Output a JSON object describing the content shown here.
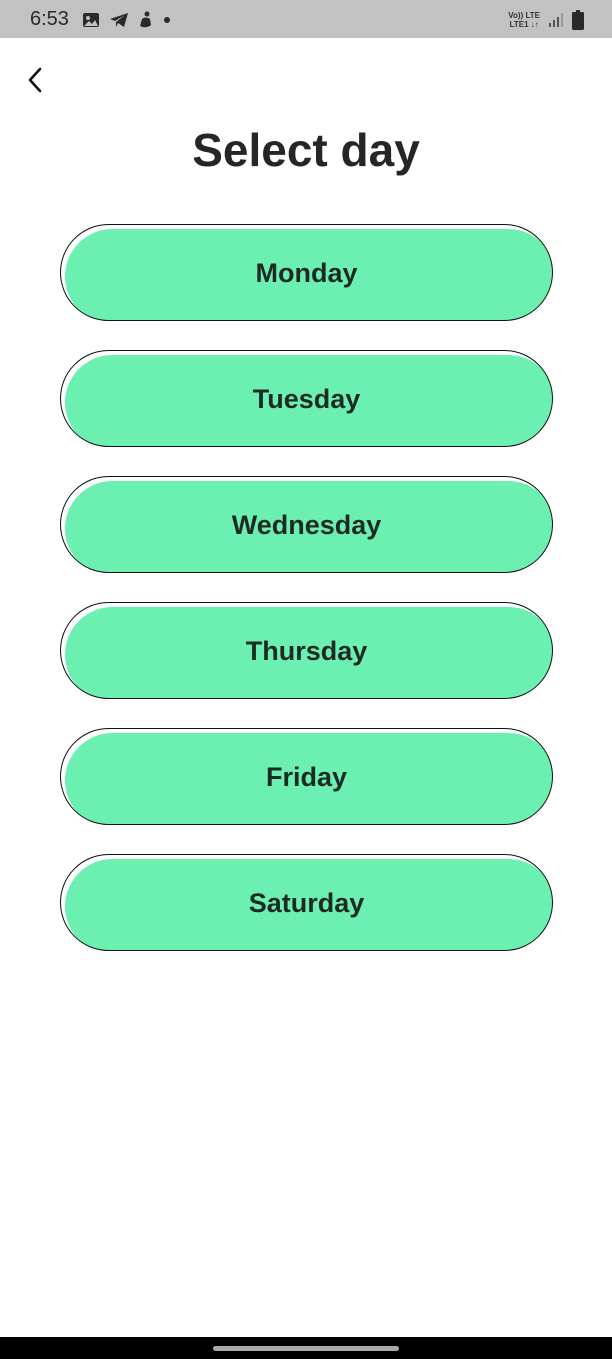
{
  "status_bar": {
    "time": "6:53",
    "left_icons": [
      "gallery-icon",
      "telegram-icon",
      "app-notification-icon",
      "dot-icon"
    ],
    "network_line1": "Vo)) LTE",
    "network_line2": "LTE1 ↓↑",
    "right_icons": [
      "signal-icon",
      "battery-icon"
    ]
  },
  "header": {
    "back_icon": "chevron-left-icon",
    "title": "Select day"
  },
  "days": [
    {
      "label": "Monday"
    },
    {
      "label": "Tuesday"
    },
    {
      "label": "Wednesday"
    },
    {
      "label": "Thursday"
    },
    {
      "label": "Friday"
    },
    {
      "label": "Saturday"
    }
  ],
  "colors": {
    "button_fill": "#6cf0b1",
    "button_border": "#111111",
    "status_bar": "#c2c2c2",
    "title_text": "#262626"
  }
}
